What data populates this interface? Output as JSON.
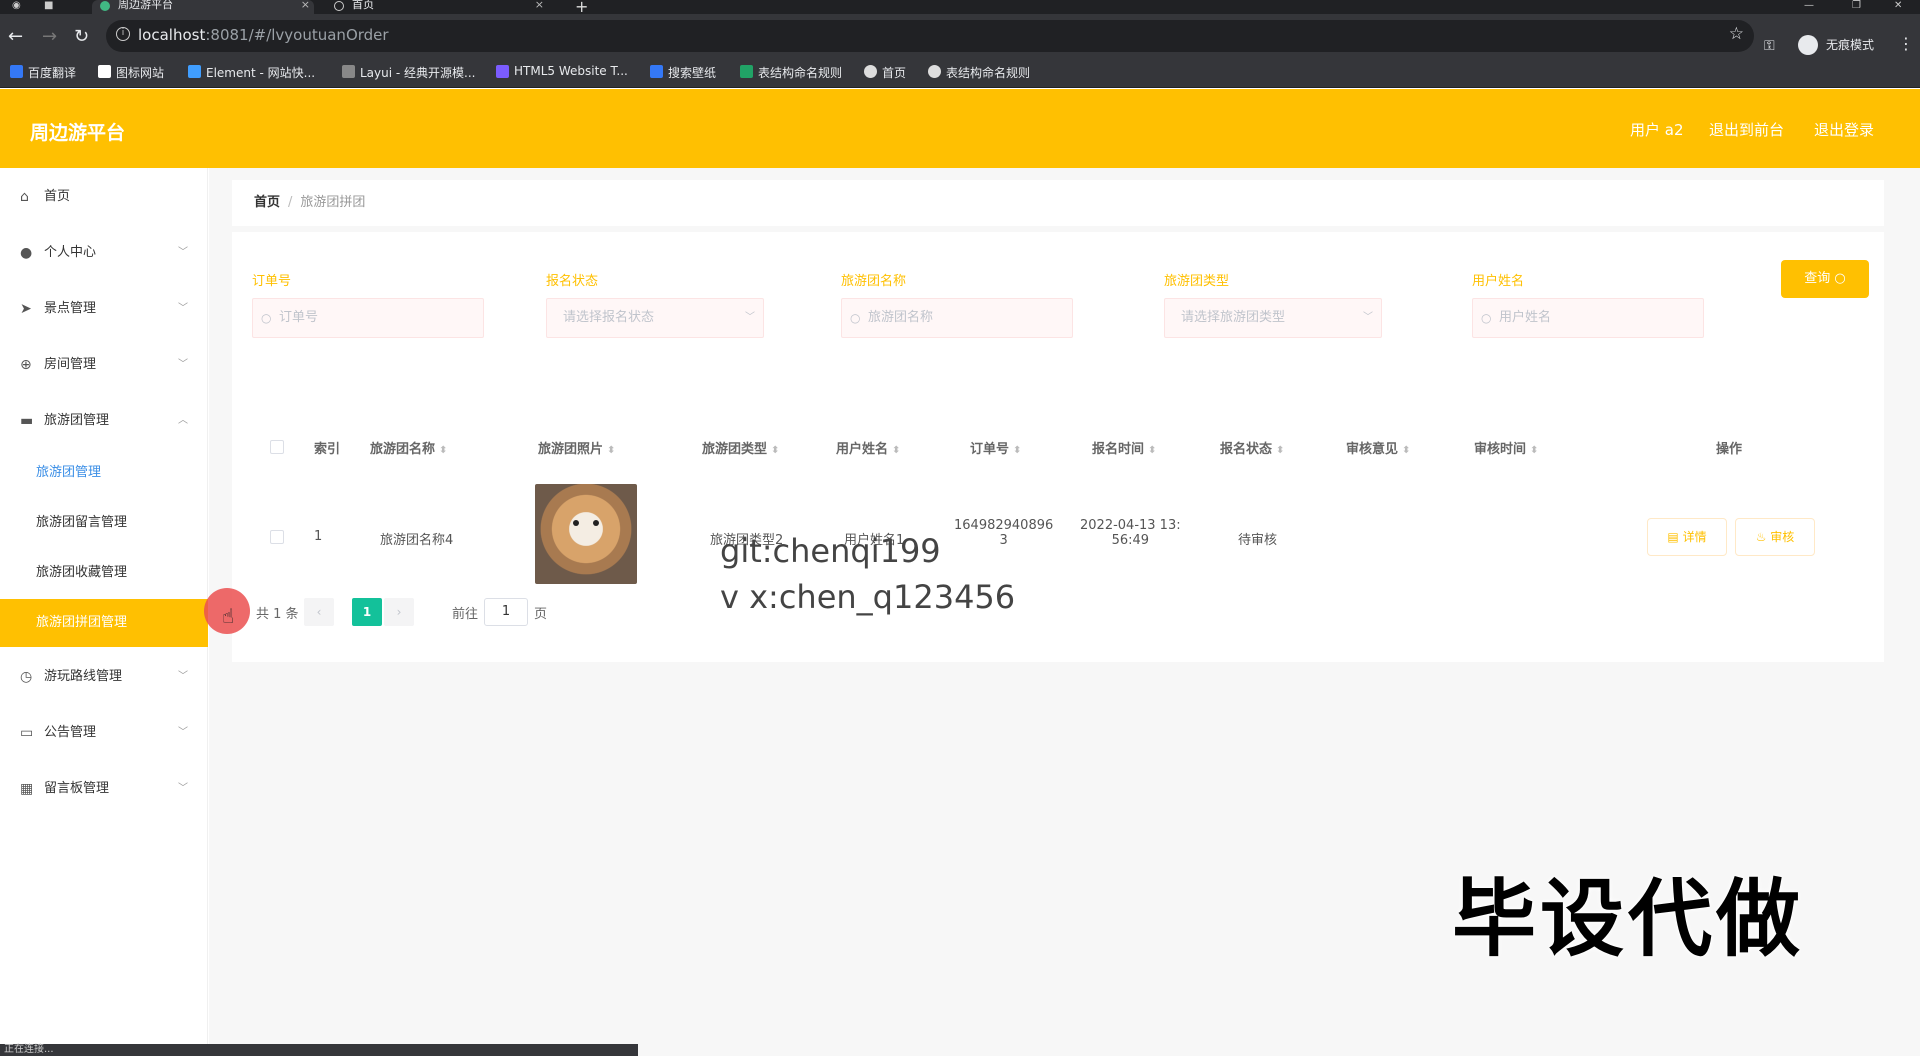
{
  "browser": {
    "tabs": [
      {
        "title": "周边游平台",
        "close": "×"
      },
      {
        "title": "首页",
        "close": "×"
      }
    ],
    "new_tab": "+",
    "url_host": "localhost",
    "url_rest": ":8081/#/lvyoutuanOrder",
    "incognito_label": "无痕模式",
    "bookmarks": [
      "百度翻译",
      "图标网站",
      "Element - 网站快...",
      "Layui - 经典开源模...",
      "HTML5 Website T...",
      "搜索壁纸",
      "表结构命名规则",
      "首页",
      "表结构命名规则"
    ],
    "status": "正在连接..."
  },
  "header": {
    "brand": "周边游平台",
    "user": "用户 a2",
    "back_front": "退出到前台",
    "logout": "退出登录"
  },
  "sidebar": {
    "items": [
      {
        "label": "首页",
        "icon": "home-icon"
      },
      {
        "label": "个人中心",
        "icon": "user-icon"
      },
      {
        "label": "景点管理",
        "icon": "send-icon"
      },
      {
        "label": "房间管理",
        "icon": "compass-icon"
      },
      {
        "label": "旅游团管理",
        "icon": "chat-icon"
      }
    ],
    "sub_items": [
      "旅游团管理",
      "旅游团留言管理",
      "旅游团收藏管理",
      "旅游团拼团管理"
    ],
    "items_after": [
      {
        "label": "游玩路线管理",
        "icon": "clock-icon"
      },
      {
        "label": "公告管理",
        "icon": "message-icon"
      },
      {
        "label": "留言板管理",
        "icon": "grid-icon"
      }
    ]
  },
  "breadcrumb": {
    "home": "首页",
    "separator": "/",
    "current": "旅游团拼团"
  },
  "filters": [
    {
      "label": "订单号",
      "placeholder": "订单号",
      "type": "input"
    },
    {
      "label": "报名状态",
      "placeholder": "请选择报名状态",
      "type": "select"
    },
    {
      "label": "旅游团名称",
      "placeholder": "旅游团名称",
      "type": "input"
    },
    {
      "label": "旅游团类型",
      "placeholder": "请选择旅游团类型",
      "type": "select"
    },
    {
      "label": "用户姓名",
      "placeholder": "用户姓名",
      "type": "input"
    }
  ],
  "query_button": "查询",
  "table": {
    "headers": [
      "索引",
      "旅游团名称",
      "旅游团照片",
      "旅游团类型",
      "用户姓名",
      "订单号",
      "报名时间",
      "报名状态",
      "审核意见",
      "审核时间",
      "操作"
    ],
    "rows": [
      {
        "index": "1",
        "name": "旅游团名称4",
        "type": "旅游团类型2",
        "user": "用户姓名1",
        "order_line1": "164982940896",
        "order_line2": "3",
        "time_line1": "2022-04-13 13:",
        "time_line2": "56:49",
        "status": "待审核",
        "opinion": "",
        "review_time": "",
        "detail_btn": "详情",
        "review_btn": "审核"
      }
    ]
  },
  "pagination": {
    "total": "共 1 条",
    "prev": "‹",
    "current": "1",
    "next": "›",
    "goto": "前往",
    "goto_value": "1",
    "page_suffix": "页"
  },
  "watermark": {
    "line1": "git:chenqi199",
    "line2": "v x:chen_q123456",
    "big": "毕设代做"
  },
  "colors": {
    "accent": "#ffc001",
    "active_page": "#13c19a",
    "link": "#3a8ee6"
  }
}
